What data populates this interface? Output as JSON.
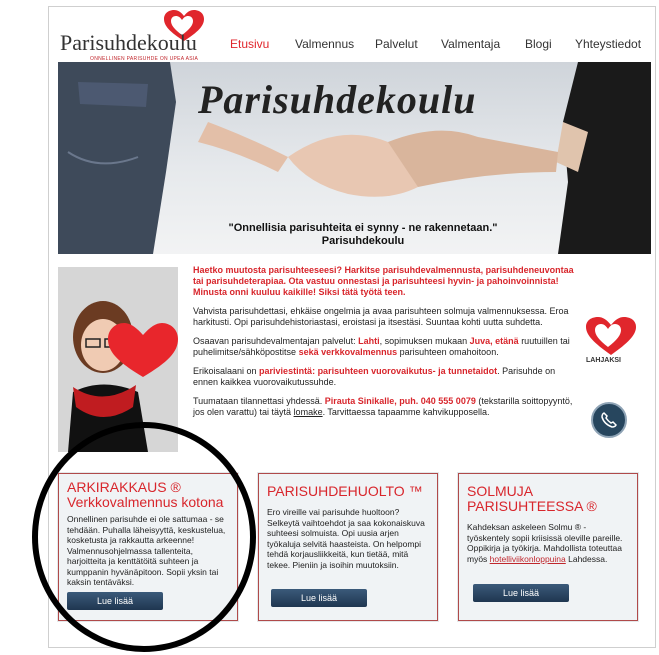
{
  "header": {
    "logo_text": "Parisuhdekoulu",
    "logo_tagline": "ONNELLINEN PARISUHDE ON UPEA ASIA",
    "nav": [
      {
        "label": "Etusivu",
        "active": true
      },
      {
        "label": "Valmennus",
        "active": false
      },
      {
        "label": "Palvelut",
        "active": false
      },
      {
        "label": "Valmentaja",
        "active": false
      },
      {
        "label": "Blogi",
        "active": false
      },
      {
        "label": "Yhteystiedot",
        "active": false
      }
    ]
  },
  "hero": {
    "title": "Parisuhdekoulu",
    "quote": "\"Onnellisia parisuhteita ei synny - ne rakennetaan.\"",
    "quote_author": "Parisuhdekoulu"
  },
  "intro": {
    "lead": "Haetko muutosta parisuhteeseesi? Harkitse parisuhdevalmennusta, parisuhdeneuvontaa tai parisuhdeterapiaa. Ota vastuu onnestasi ja parisuhteesi hyvin- ja pahoinvoinnista! Minusta onni kuuluu kaikille! Siksi tätä työtä teen.",
    "p1": "Vahvista parisuhdettasi, ehkäise ongelmia ja avaa parisuhteen solmuja valmennuksessa. Eroa harkitusti. Opi parisuhdehistoriastasi, eroistasi ja itsestäsi. Suuntaa kohti uutta suhdetta.",
    "p2_start": "Osaavan parisuhdevalmentajan palvelut: ",
    "p2_loc1": "Lahti",
    "p2_mid": ", sopimuksen mukaan ",
    "p2_loc2": "Juva, etänä",
    "p2_mid2": " ruutuillen tai puhelimitse/sähköpostitse ",
    "p2_bold": "sekä verkkovalmennus",
    "p2_end": " parisuhteen omahoitoon.",
    "p3_start": "Erikoisalaani on ",
    "p3_bold": "pariviestintä: parisuhteen vuorovaikutus- ja tunnetaidot",
    "p3_end": ". Parisuhde on ennen kaikkea vuorovaikutussuhde.",
    "p4_start": "Tuumataan tilannettasi yhdessä. ",
    "p4_bold": "Pirauta Sinikalle, puh. 040 555 0079",
    "p4_mid": " (tekstarilla soittopyyntö, jos olen varattu) tai täytä ",
    "p4_link": "lomake",
    "p4_end": ". Tarvittaessa tapaamme kahvikupposella."
  },
  "side": {
    "lahjaksi": "LAHJAKSI"
  },
  "cards": [
    {
      "title_line1": "ARKIRAKKAUS ®",
      "title_line2": "Verkkovalmennus kotona",
      "text": "Onnellinen parisuhde ei ole sattumaa - se tehdään. Puhalla läheisyyttä, keskustelua, kosketusta ja rakkautta arkeenne! Valmennusohjelmassa tallenteita, harjoitteita ja kenttätöitä suhteen ja kumppanin hyvänäpitoon. Sopii yksin tai kaksin tentäväksi.",
      "button": "Lue lisää"
    },
    {
      "title_line1": "PARISUHDEHUOLTO ™",
      "title_line2": "",
      "text": "Ero vireille vai parisuhde huoltoon? Selkeytä vaihtoehdot ja saa kokonaiskuva suhteesi solmuista. Opi uusia arjen työkaluja selvitä haasteista. On helpompi tehdä korjausliikkeitä, kun tietää, mitä tekee. Pieniin ja isoihin muutoksiin.",
      "button": "Lue lisää"
    },
    {
      "title_line1": "SOLMUJA",
      "title_line2": "PARISUHTEESSA ®",
      "text_start": "Kahdeksan askeleen Solmu ® -työskentely sopii kriisissä oleville pareille. Oppikirja ja työkirja. Mahdollista toteuttaa myös ",
      "text_link": "hotelliviikonloppuina",
      "text_end": " Lahdessa.",
      "button": "Lue lisää"
    }
  ],
  "colors": {
    "accent_red": "#e0262c",
    "button_navy": "#1f3650"
  }
}
